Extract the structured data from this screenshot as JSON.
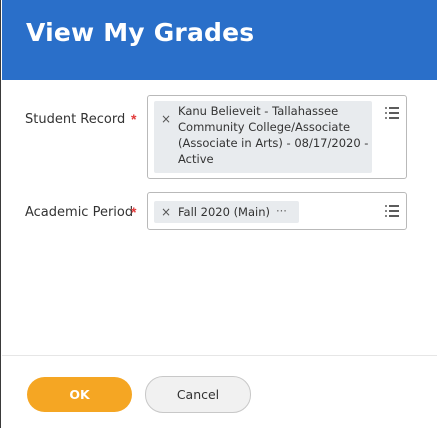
{
  "header": {
    "title": "View My Grades"
  },
  "form": {
    "student_record": {
      "label": "Student Record",
      "required_mark": "*",
      "value_lines": [
        "Kanu Believeit - Tallahassee",
        "Community College/Associate",
        "(Associate in Arts) - 08/17/2020 -",
        "Active"
      ],
      "remove_glyph": "×",
      "icon": "list-menu-icon"
    },
    "academic_period": {
      "label": "Academic Period",
      "required_mark": "*",
      "value": "Fall 2020 (Main)",
      "more_glyph": "···",
      "remove_glyph": "×",
      "icon": "list-menu-icon"
    }
  },
  "footer": {
    "ok_label": "OK",
    "cancel_label": "Cancel"
  },
  "colors": {
    "header": "#2a6fc9",
    "ok": "#f5a623",
    "required": "#e23b3b",
    "pill": "#e8ebee"
  }
}
